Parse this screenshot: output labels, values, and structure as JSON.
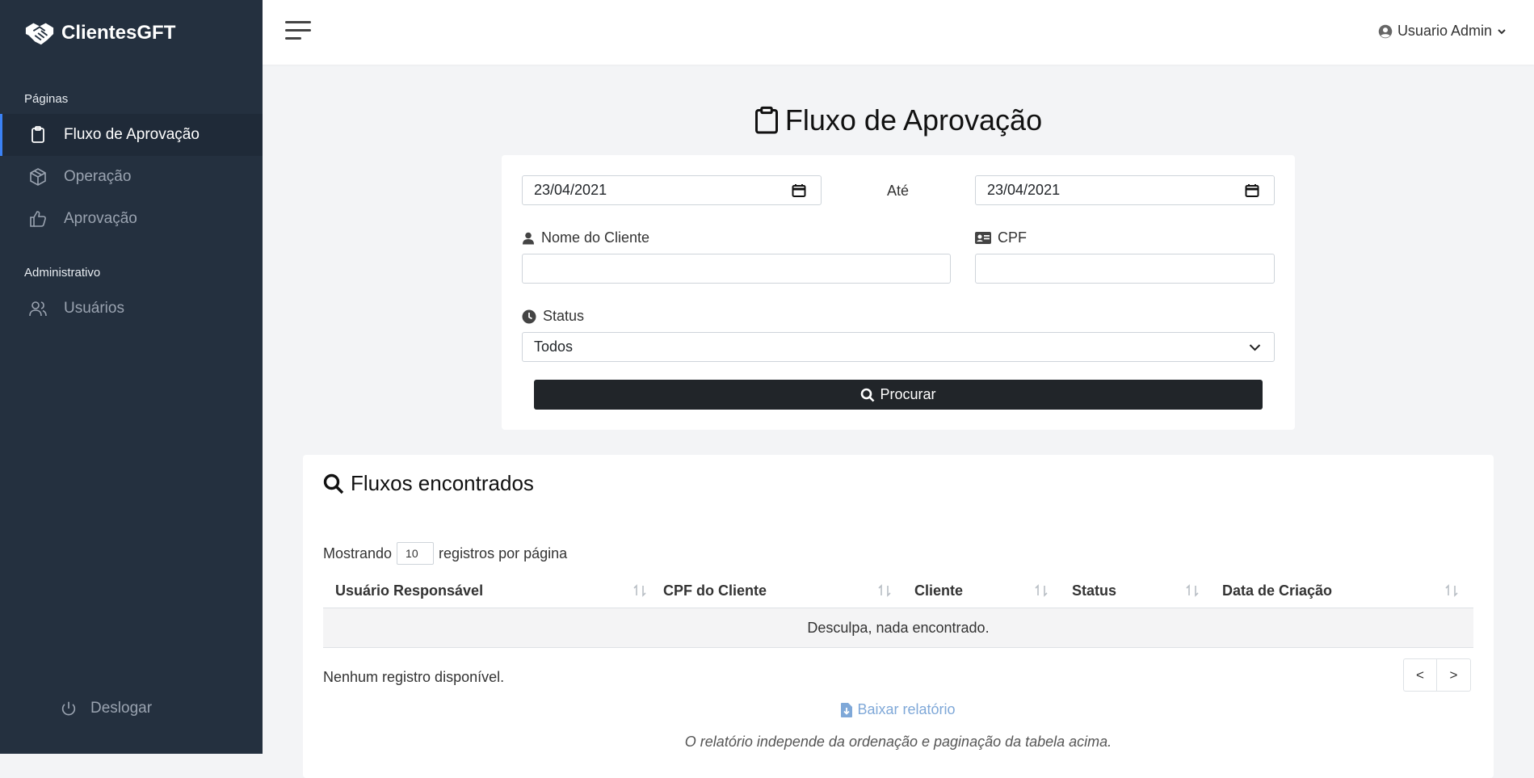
{
  "brand": {
    "name": "ClientesGFT",
    "icon": "handshake-icon"
  },
  "sidebar": {
    "sections": [
      {
        "label": "Páginas"
      },
      {
        "label": "Administrativo"
      }
    ],
    "items": [
      {
        "label": "Fluxo de Aprovação",
        "icon": "clipboard-icon",
        "active": true
      },
      {
        "label": "Operação",
        "icon": "box-icon"
      },
      {
        "label": "Aprovação",
        "icon": "thumbs-up-icon"
      },
      {
        "label": "Usuários",
        "icon": "users-icon"
      }
    ],
    "logout_label": "Deslogar"
  },
  "topbar": {
    "user_name": "Usuario Admin"
  },
  "page": {
    "title": "Fluxo de Aprovação"
  },
  "filters": {
    "date_from": "23/04/2021",
    "date_to_label": "Até",
    "date_to": "23/04/2021",
    "client_name_label": "Nome do Cliente",
    "client_name_value": "",
    "cpf_label": "CPF",
    "cpf_value": "",
    "status_label": "Status",
    "status_value": "Todos",
    "search_label": "Procurar"
  },
  "results": {
    "title": "Fluxos encontrados",
    "length_prefix": "Mostrando",
    "length_value": "10",
    "length_suffix": "registros por página",
    "columns": [
      "Usuário Responsável",
      "CPF do Cliente",
      "Cliente",
      "Status",
      "Data de Criação"
    ],
    "empty_message": "Desculpa, nada encontrado.",
    "info": "Nenhum registro disponível.",
    "prev_label": "<",
    "next_label": ">",
    "report_link": "Baixar relatório",
    "report_note": "O relatório independe da ordenação e paginação da tabela acima."
  },
  "colors": {
    "sidebar_bg": "#24303f",
    "active_accent": "#3b82f6",
    "button_dark": "#212529",
    "link_blue": "#7fa8d8"
  }
}
